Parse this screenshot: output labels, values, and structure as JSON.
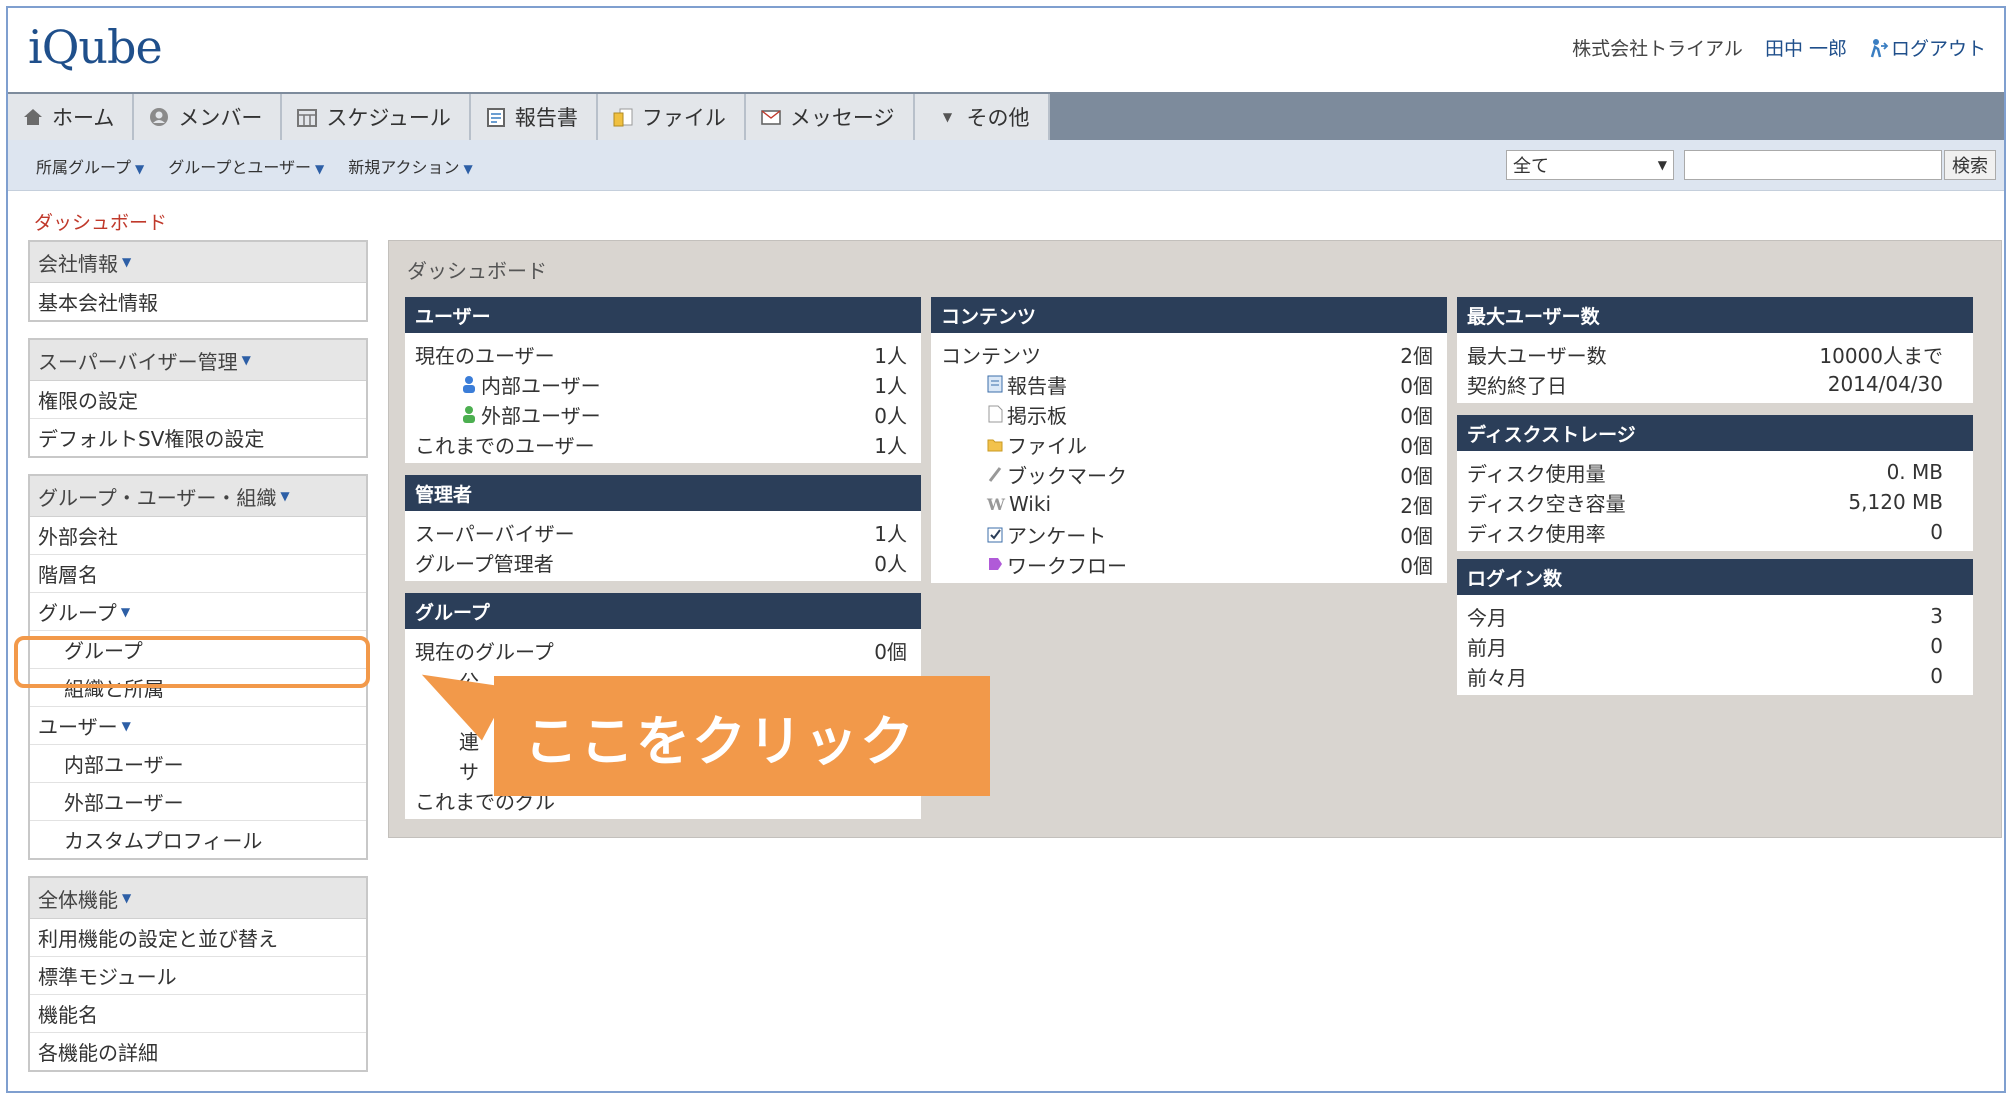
{
  "header": {
    "logo": "iQube",
    "company": "株式会社トライアル",
    "user": "田中 一郎",
    "logout": "ログアウト"
  },
  "nav": {
    "tabs": [
      {
        "label": "ホーム",
        "icon": "home-icon"
      },
      {
        "label": "メンバー",
        "icon": "members-icon"
      },
      {
        "label": "スケジュール",
        "icon": "schedule-icon"
      },
      {
        "label": "報告書",
        "icon": "report-icon"
      },
      {
        "label": "ファイル",
        "icon": "file-icon"
      },
      {
        "label": "メッセージ",
        "icon": "message-icon"
      },
      {
        "label": "その他",
        "icon": "dropdown-icon"
      }
    ]
  },
  "subnav": {
    "menus": [
      "所属グループ",
      "グループとユーザー",
      "新規アクション"
    ],
    "search_select": "全て",
    "search_button": "検索"
  },
  "breadcrumb": "ダッシュボード",
  "sidebar": {
    "company": {
      "title": "会社情報",
      "items": [
        "基本会社情報"
      ]
    },
    "supervisor": {
      "title": "スーパーバイザー管理",
      "items": [
        "権限の設定",
        "デフォルトSV権限の設定"
      ]
    },
    "org": {
      "title": "グループ・ユーザー・組織",
      "items": [
        "外部会社",
        "階層名"
      ],
      "group_head": "グループ",
      "group_items": [
        "グループ",
        "組織と所属"
      ],
      "user_head": "ユーザー",
      "user_items": [
        "内部ユーザー",
        "外部ユーザー",
        "カスタムプロフィール"
      ]
    },
    "features": {
      "title": "全体機能",
      "items": [
        "利用機能の設定と並び替え",
        "標準モジュール",
        "機能名",
        "各機能の詳細"
      ]
    }
  },
  "main": {
    "title": "ダッシュボード",
    "users": {
      "title": "ユーザー",
      "rows": [
        {
          "label": "現在のユーザー",
          "value": "1人"
        },
        {
          "label": "内部ユーザー",
          "value": "1人"
        },
        {
          "label": "外部ユーザー",
          "value": "0人"
        },
        {
          "label": "これまでのユーザー",
          "value": "1人"
        }
      ]
    },
    "admins": {
      "title": "管理者",
      "rows": [
        {
          "label": "スーパーバイザー",
          "value": "1人"
        },
        {
          "label": "グループ管理者",
          "value": "0人"
        }
      ]
    },
    "groups": {
      "title": "グループ",
      "rows": [
        {
          "label": "現在のグループ",
          "value": "0個"
        },
        {
          "label": "公",
          "value": ""
        },
        {
          "label": "",
          "value": ""
        },
        {
          "label": "連",
          "value": ""
        },
        {
          "label": "サ",
          "value": ""
        },
        {
          "label": "これまでのグル",
          "value": ""
        }
      ]
    },
    "contents": {
      "title": "コンテンツ",
      "rows": [
        {
          "label": "コンテンツ",
          "value": "2個"
        },
        {
          "label": "報告書",
          "value": "0個"
        },
        {
          "label": "掲示板",
          "value": "0個"
        },
        {
          "label": "ファイル",
          "value": "0個"
        },
        {
          "label": "ブックマーク",
          "value": "0個"
        },
        {
          "label": "Wiki",
          "value": "2個"
        },
        {
          "label": "アンケート",
          "value": "0個"
        },
        {
          "label": "ワークフロー",
          "value": "0個"
        }
      ]
    },
    "max_users": {
      "title": "最大ユーザー数",
      "rows": [
        {
          "label": "最大ユーザー数",
          "value": "10000人まで"
        },
        {
          "label": "契約終了日",
          "value": "2014/04/30"
        }
      ]
    },
    "disk": {
      "title": "ディスクストレージ",
      "rows": [
        {
          "label": "ディスク使用量",
          "value": "0. MB"
        },
        {
          "label": "ディスク空き容量",
          "value": "5,120 MB"
        },
        {
          "label": "ディスク使用率",
          "value": "0"
        }
      ]
    },
    "logins": {
      "title": "ログイン数",
      "rows": [
        {
          "label": "今月",
          "value": "3"
        },
        {
          "label": "前月",
          "value": "0"
        },
        {
          "label": "前々月",
          "value": "0"
        }
      ]
    }
  },
  "callout": "ここをクリック"
}
